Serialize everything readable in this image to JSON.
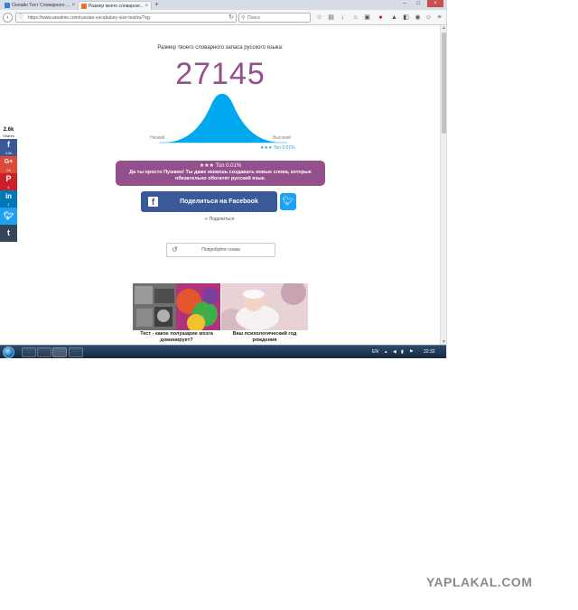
{
  "browser": {
    "tabs": [
      {
        "title": "Онлайн Тест Словарного ..."
      },
      {
        "title": "Размер моего словарног..."
      }
    ],
    "new_tab": "+",
    "url": "https://www.arealme.com/russian-vocabulary-size-test/ru/?sg",
    "search_placeholder": "Поиск"
  },
  "sidebar": {
    "shares_count": "2.6k",
    "shares_label": "Shares",
    "buttons": [
      {
        "icon": "f",
        "count": "2.6k",
        "color": "#3b5998"
      },
      {
        "icon": "G+",
        "count": "24",
        "color": "#dd4b39"
      },
      {
        "icon": "P",
        "count": "1",
        "color": "#cb2027"
      },
      {
        "icon": "in",
        "count": "1",
        "color": "#0077b5"
      },
      {
        "icon": "t",
        "count": "",
        "color": "#1da1f2"
      },
      {
        "icon": "t",
        "count": "",
        "color": "#35465c"
      }
    ]
  },
  "result": {
    "headline": "Размер твоего словарного запаса русского языка:",
    "score": "27145",
    "label_low": "Низкий",
    "label_high": "Высокий",
    "rank_small": "★★★ Топ 0.01%",
    "percentile_marker": 0.95,
    "accent_color": "#93508c",
    "curve_color": "#00a8f0"
  },
  "banner": {
    "title": "★★★ Топ 0.01%",
    "message": "Да ты просто Пушкин! Ты даже можешь создавать новые слова, которые обязательно обогатят русский язык."
  },
  "share": {
    "facebook_label": "Поделиться на Facebook",
    "share_link": "Поделиться"
  },
  "retry": {
    "label": "Попробуйте снова"
  },
  "cards": [
    {
      "caption": "Тест - какое полушарие мозга доминирует?"
    },
    {
      "caption": "Ваш психологический год рождения"
    }
  ],
  "taskbar": {
    "lang": "EN",
    "time": "22:32"
  },
  "watermark": "YAPLAKAL.COM"
}
